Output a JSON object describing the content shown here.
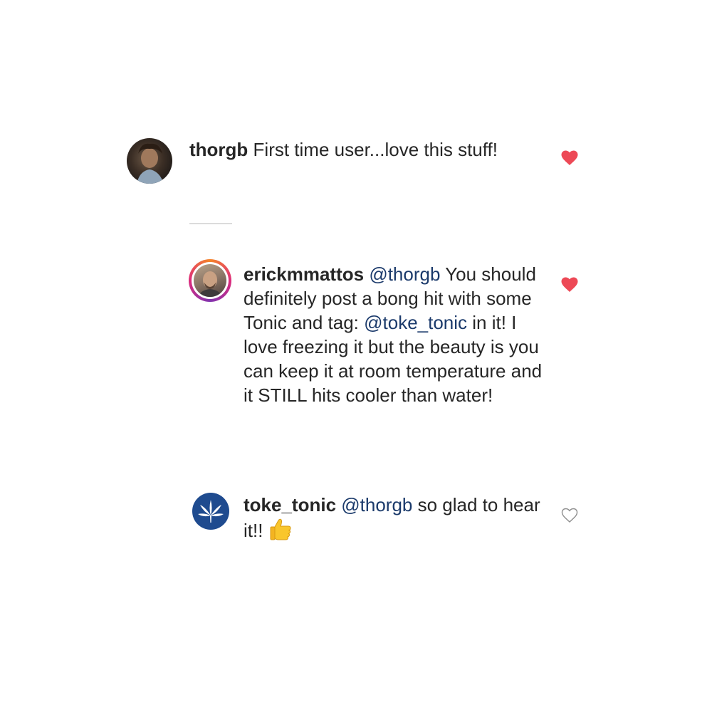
{
  "comments": [
    {
      "username": "thorgb",
      "text": "First time user...love this stuff!",
      "liked": true
    },
    {
      "username": "erickmmattos",
      "mention1": "@thorgb",
      "text1": " You should definitely post a bong hit with some Tonic and tag: ",
      "mention2": "@toke_tonic",
      "text2": " in it! I love freezing it but the beauty is you can keep it at room temperature and it STILL hits cooler than water!",
      "liked": true
    },
    {
      "username": "toke_tonic",
      "mention1": "@thorgb",
      "text1": " so glad to hear it!! ",
      "emoji": "thumbs-up-emoji",
      "liked": false
    }
  ],
  "colors": {
    "liked_heart": "#ed4956",
    "unliked_heart": "#8e8e8e",
    "mention": "#1b3a6b",
    "username": "#262626"
  },
  "icons": [
    "heart-filled-icon",
    "heart-outline-icon",
    "cannabis-leaf-icon",
    "thumbs-up-emoji"
  ]
}
